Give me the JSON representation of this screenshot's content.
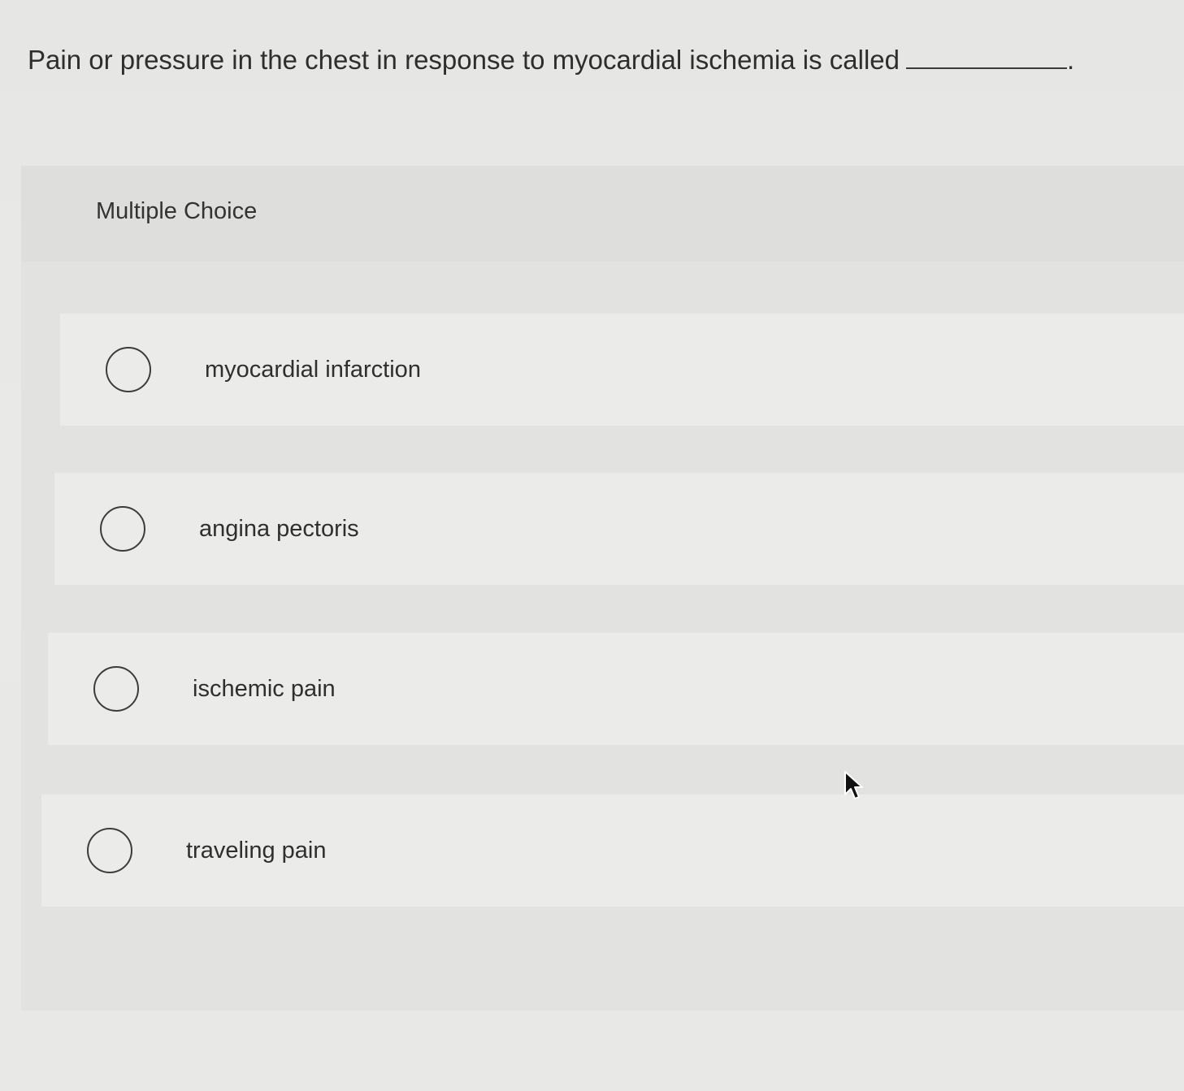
{
  "question": {
    "text": "Pain or pressure in the chest in response to myocardial ischemia is called",
    "end_punct": "."
  },
  "panel": {
    "title": "Multiple Choice"
  },
  "options": [
    {
      "label": "myocardial infarction"
    },
    {
      "label": "angina pectoris"
    },
    {
      "label": "ischemic pain"
    },
    {
      "label": "traveling pain"
    }
  ],
  "colors": {
    "page_bg": "#e8e8e6",
    "panel_bg": "#e2e2e0",
    "option_bg": "#ebebe9",
    "text": "#2e2e2e"
  },
  "icons": {
    "radio": "radio-unselected-icon",
    "cursor": "mouse-pointer-icon"
  }
}
